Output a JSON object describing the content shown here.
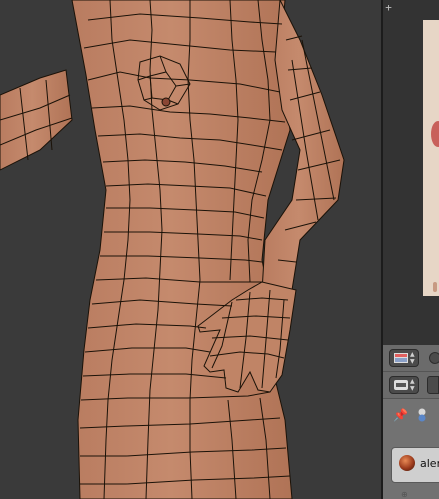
{
  "viewport": {
    "skin_color": "#c0876a",
    "background_color": "#3a3a3a",
    "wire_color": "#1b1208"
  },
  "image_editor": {
    "split_widgets": [
      "+",
      "+"
    ]
  },
  "properties": {
    "material_name": "alen"
  },
  "icons": [
    "editor-type-icon",
    "context-icon",
    "pin-icon",
    "material-data-icon",
    "material-sphere-icon",
    "add-slot-icon"
  ]
}
